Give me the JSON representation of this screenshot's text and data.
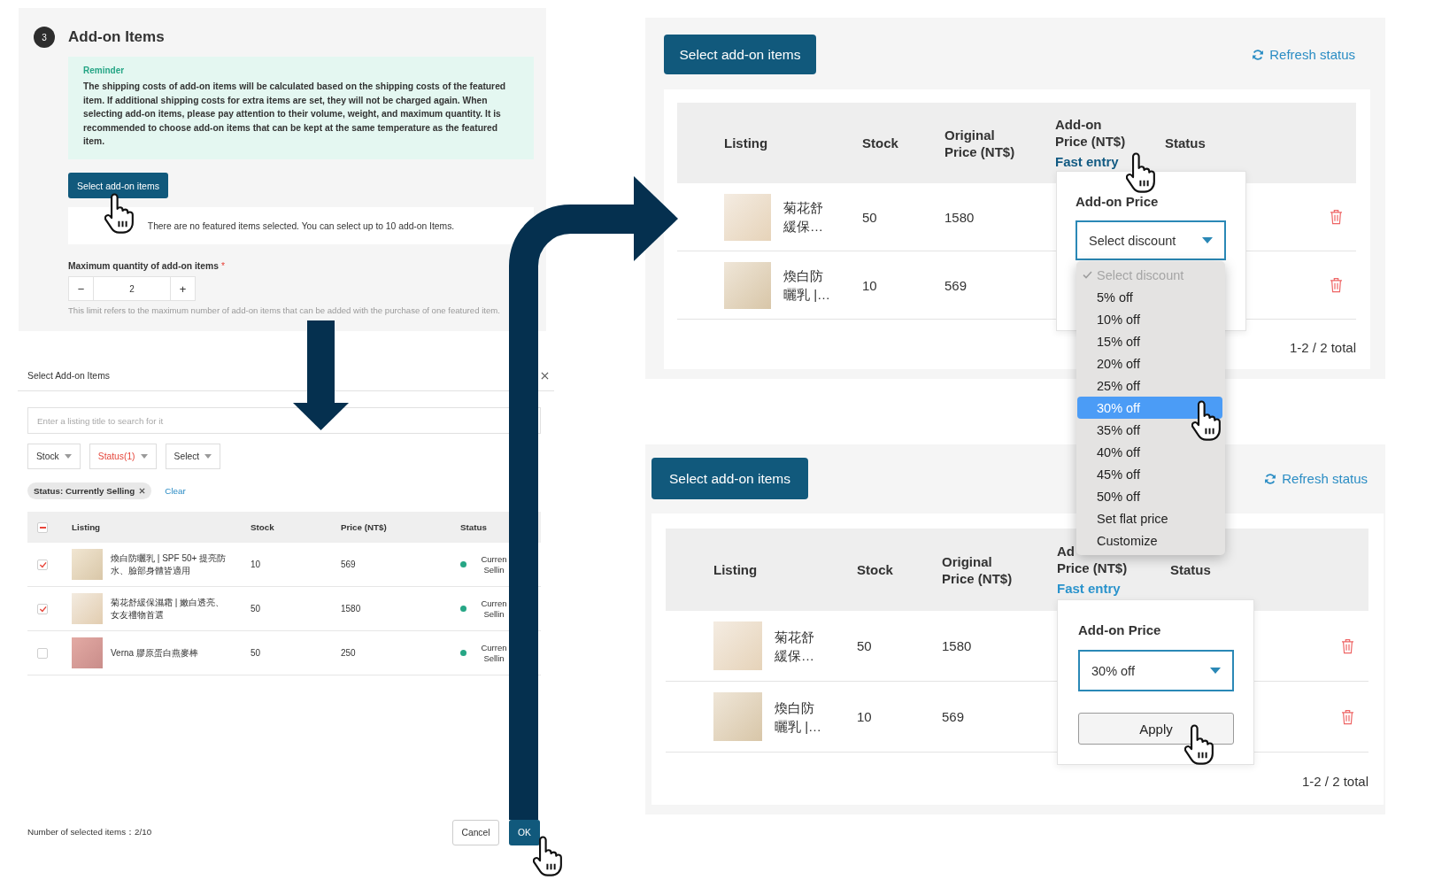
{
  "add_on_section": {
    "step": "3",
    "title": "Add-on Items",
    "reminder": {
      "title": "Reminder",
      "text": "The shipping costs of add-on items will be calculated based on the shipping costs of the featured item. If additional shipping costs for extra items are set, they will not be charged again. When selecting add-on items, please pay attention to their volume, weight, and maximum quantity. It is recommended to choose add-on items that can be kept at the same temperature as the featured item."
    },
    "select_button": "Select add-on items",
    "empty_note": "There are no featured items selected. You can select up to 10 add-on Items.",
    "quantity": {
      "label": "Maximum quantity of add-on items",
      "required_mark": "*",
      "minus": "−",
      "value": "2",
      "plus": "+",
      "hint": "This limit refers to the maximum number of add-on items that can be added with the purchase of one featured item."
    }
  },
  "select_dialog": {
    "title": "Select Add-on Items",
    "search": {
      "placeholder": "Enter a listing title to search for it"
    },
    "filters": [
      {
        "label": "Stock",
        "active": false
      },
      {
        "label": "Status(1)",
        "active": true
      },
      {
        "label": "Select",
        "active": false
      }
    ],
    "chips": [
      {
        "label": "Status: Currently Selling"
      }
    ],
    "clear": "Clear",
    "table": {
      "header_checkbox": {
        "indeterminate": true
      },
      "columns": [
        "Listing",
        "Stock",
        "Price (NT$)",
        "Status"
      ],
      "rows": [
        {
          "checked": true,
          "name": "煥白防曬乳 | SPF 50+ 提亮防水、臉部身體皆適用",
          "stock": "10",
          "price": "569",
          "color": "#26a685",
          "status": "Curren Sellin"
        },
        {
          "checked": true,
          "name": "菊花舒緩保濕霜 | 嫩白透亮、女友禮物首選",
          "stock": "50",
          "price": "1580",
          "color": "#26a685",
          "status": "Curren Sellin"
        },
        {
          "checked": false,
          "name": "Verna 膠原蛋白燕麥棒",
          "stock": "50",
          "price": "250",
          "color": "#26a685",
          "status": "Curren Sellin"
        }
      ]
    },
    "selected_count": "Number of selected items：2/10",
    "buttons": [
      {
        "label": "Cancel",
        "kind": "secondary"
      },
      {
        "label": "OK",
        "kind": "primary"
      }
    ]
  },
  "add_on_tables": [
    {
      "select_button": "Select add-on items",
      "refresh": "Refresh status",
      "columns": [
        {
          "lines": [
            "Listing"
          ]
        },
        {
          "lines": [
            "Stock"
          ]
        },
        {
          "lines": [
            "Original Price (NT$)"
          ]
        },
        {
          "lines": [
            "Add-on Price (NT$)"
          ],
          "link": "Fast entry",
          "link_hovered": true
        },
        {
          "lines": [
            "Status"
          ]
        }
      ],
      "rows": [
        {
          "name": "菊花舒緩保…",
          "stock": "50",
          "price": "1580"
        },
        {
          "name": "煥白防曬乳 |…",
          "stock": "10",
          "price": "569"
        }
      ],
      "pagination": "1-2 / 2 total",
      "popover": {
        "title": "Add-on Price",
        "select_value": "Select discount"
      },
      "dropdown": {
        "options": [
          {
            "label": "Select discount",
            "checked": true,
            "disabled": true,
            "selected": false
          },
          {
            "label": "5% off",
            "checked": false,
            "disabled": false,
            "selected": false
          },
          {
            "label": "10% off",
            "checked": false,
            "disabled": false,
            "selected": false
          },
          {
            "label": "15% off",
            "checked": false,
            "disabled": false,
            "selected": false
          },
          {
            "label": "20% off",
            "checked": false,
            "disabled": false,
            "selected": false
          },
          {
            "label": "25% off",
            "checked": false,
            "disabled": false,
            "selected": false
          },
          {
            "label": "30% off",
            "checked": false,
            "disabled": false,
            "selected": true
          },
          {
            "label": "35% off",
            "checked": false,
            "disabled": false,
            "selected": false
          },
          {
            "label": "40% off",
            "checked": false,
            "disabled": false,
            "selected": false
          },
          {
            "label": "45% off",
            "checked": false,
            "disabled": false,
            "selected": false
          },
          {
            "label": "50% off",
            "checked": false,
            "disabled": false,
            "selected": false
          },
          {
            "label": "Set flat price",
            "checked": false,
            "disabled": false,
            "selected": false
          },
          {
            "label": "Customize",
            "checked": false,
            "disabled": false,
            "selected": false
          }
        ]
      }
    },
    {
      "select_button": "Select add-on items",
      "refresh": "Refresh status",
      "columns": [
        {
          "lines": [
            "Listing"
          ]
        },
        {
          "lines": [
            "Stock"
          ]
        },
        {
          "lines": [
            "Original Price (NT$)"
          ]
        },
        {
          "lines": [
            "Ad",
            "Price (NT$)"
          ],
          "link": "Fast entry",
          "link_hovered": false
        },
        {
          "lines": [
            "Status"
          ]
        }
      ],
      "rows": [
        {
          "name": "菊花舒緩保…",
          "stock": "50",
          "price": "1580"
        },
        {
          "name": "煥白防曬乳 |…",
          "stock": "10",
          "price": "569"
        }
      ],
      "pagination": "1-2 / 2 total",
      "popover": {
        "title": "Add-on Price",
        "select_value": "30% off",
        "apply": "Apply"
      }
    }
  ]
}
